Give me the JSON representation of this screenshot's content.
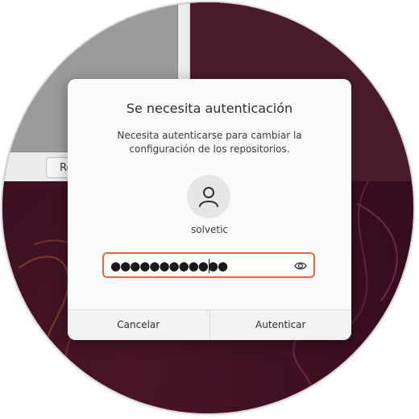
{
  "background_window": {
    "button_label": "Re"
  },
  "dialog": {
    "title": "Se necesita autenticación",
    "message": "Necesita autenticarse para cambiar la configuración de los repositorios.",
    "avatar_icon": "user-icon",
    "username": "solvetic",
    "password_masked": "●●●●●●●●●●●●",
    "password_field_icon": "eye-icon",
    "cancel_label": "Cancelar",
    "authenticate_label": "Autenticar"
  },
  "colors": {
    "accent": "#e9663f",
    "wallpaper": "#3b0f21"
  }
}
